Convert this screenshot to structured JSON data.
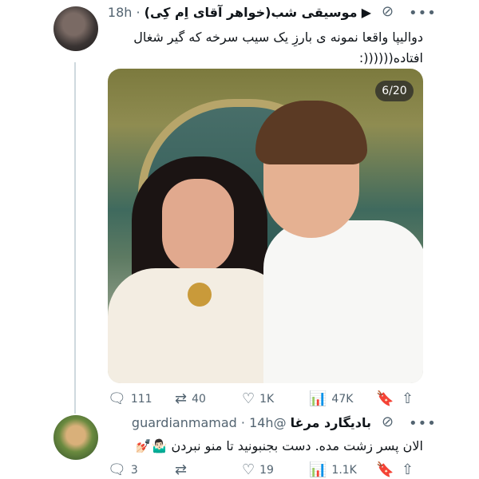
{
  "tweet1": {
    "author_name": "موسیقی شب(خواهر آقای اِم کِی)",
    "time": "18h",
    "text_line1": "دوالیپا واقعا نمونه ی بارزِ یک سیب سرخه که گیر شغال",
    "text_line2": "افتاده((((((:",
    "media_counter": "6/20",
    "stats": {
      "replies": "111",
      "retweets": "40",
      "likes": "1K",
      "views": "47K"
    }
  },
  "tweet2": {
    "author_name": "بادیگارد مرغا",
    "handle": "@guardianmamad",
    "time": "14h",
    "text": "الان پسر زشت مده. دست بجنبونید تا منو نبردن 🤷🏻‍♂️💅🏻",
    "stats": {
      "replies": "3",
      "likes": "19",
      "views": "1.1K"
    }
  },
  "icons": {
    "more": "more-horizontal-icon",
    "grok": "grok-icon",
    "bird": "bird-icon",
    "reply": "reply-icon",
    "retweet": "retweet-icon",
    "like": "heart-icon",
    "views": "analytics-icon",
    "bookmark": "bookmark-icon",
    "share": "share-icon"
  }
}
